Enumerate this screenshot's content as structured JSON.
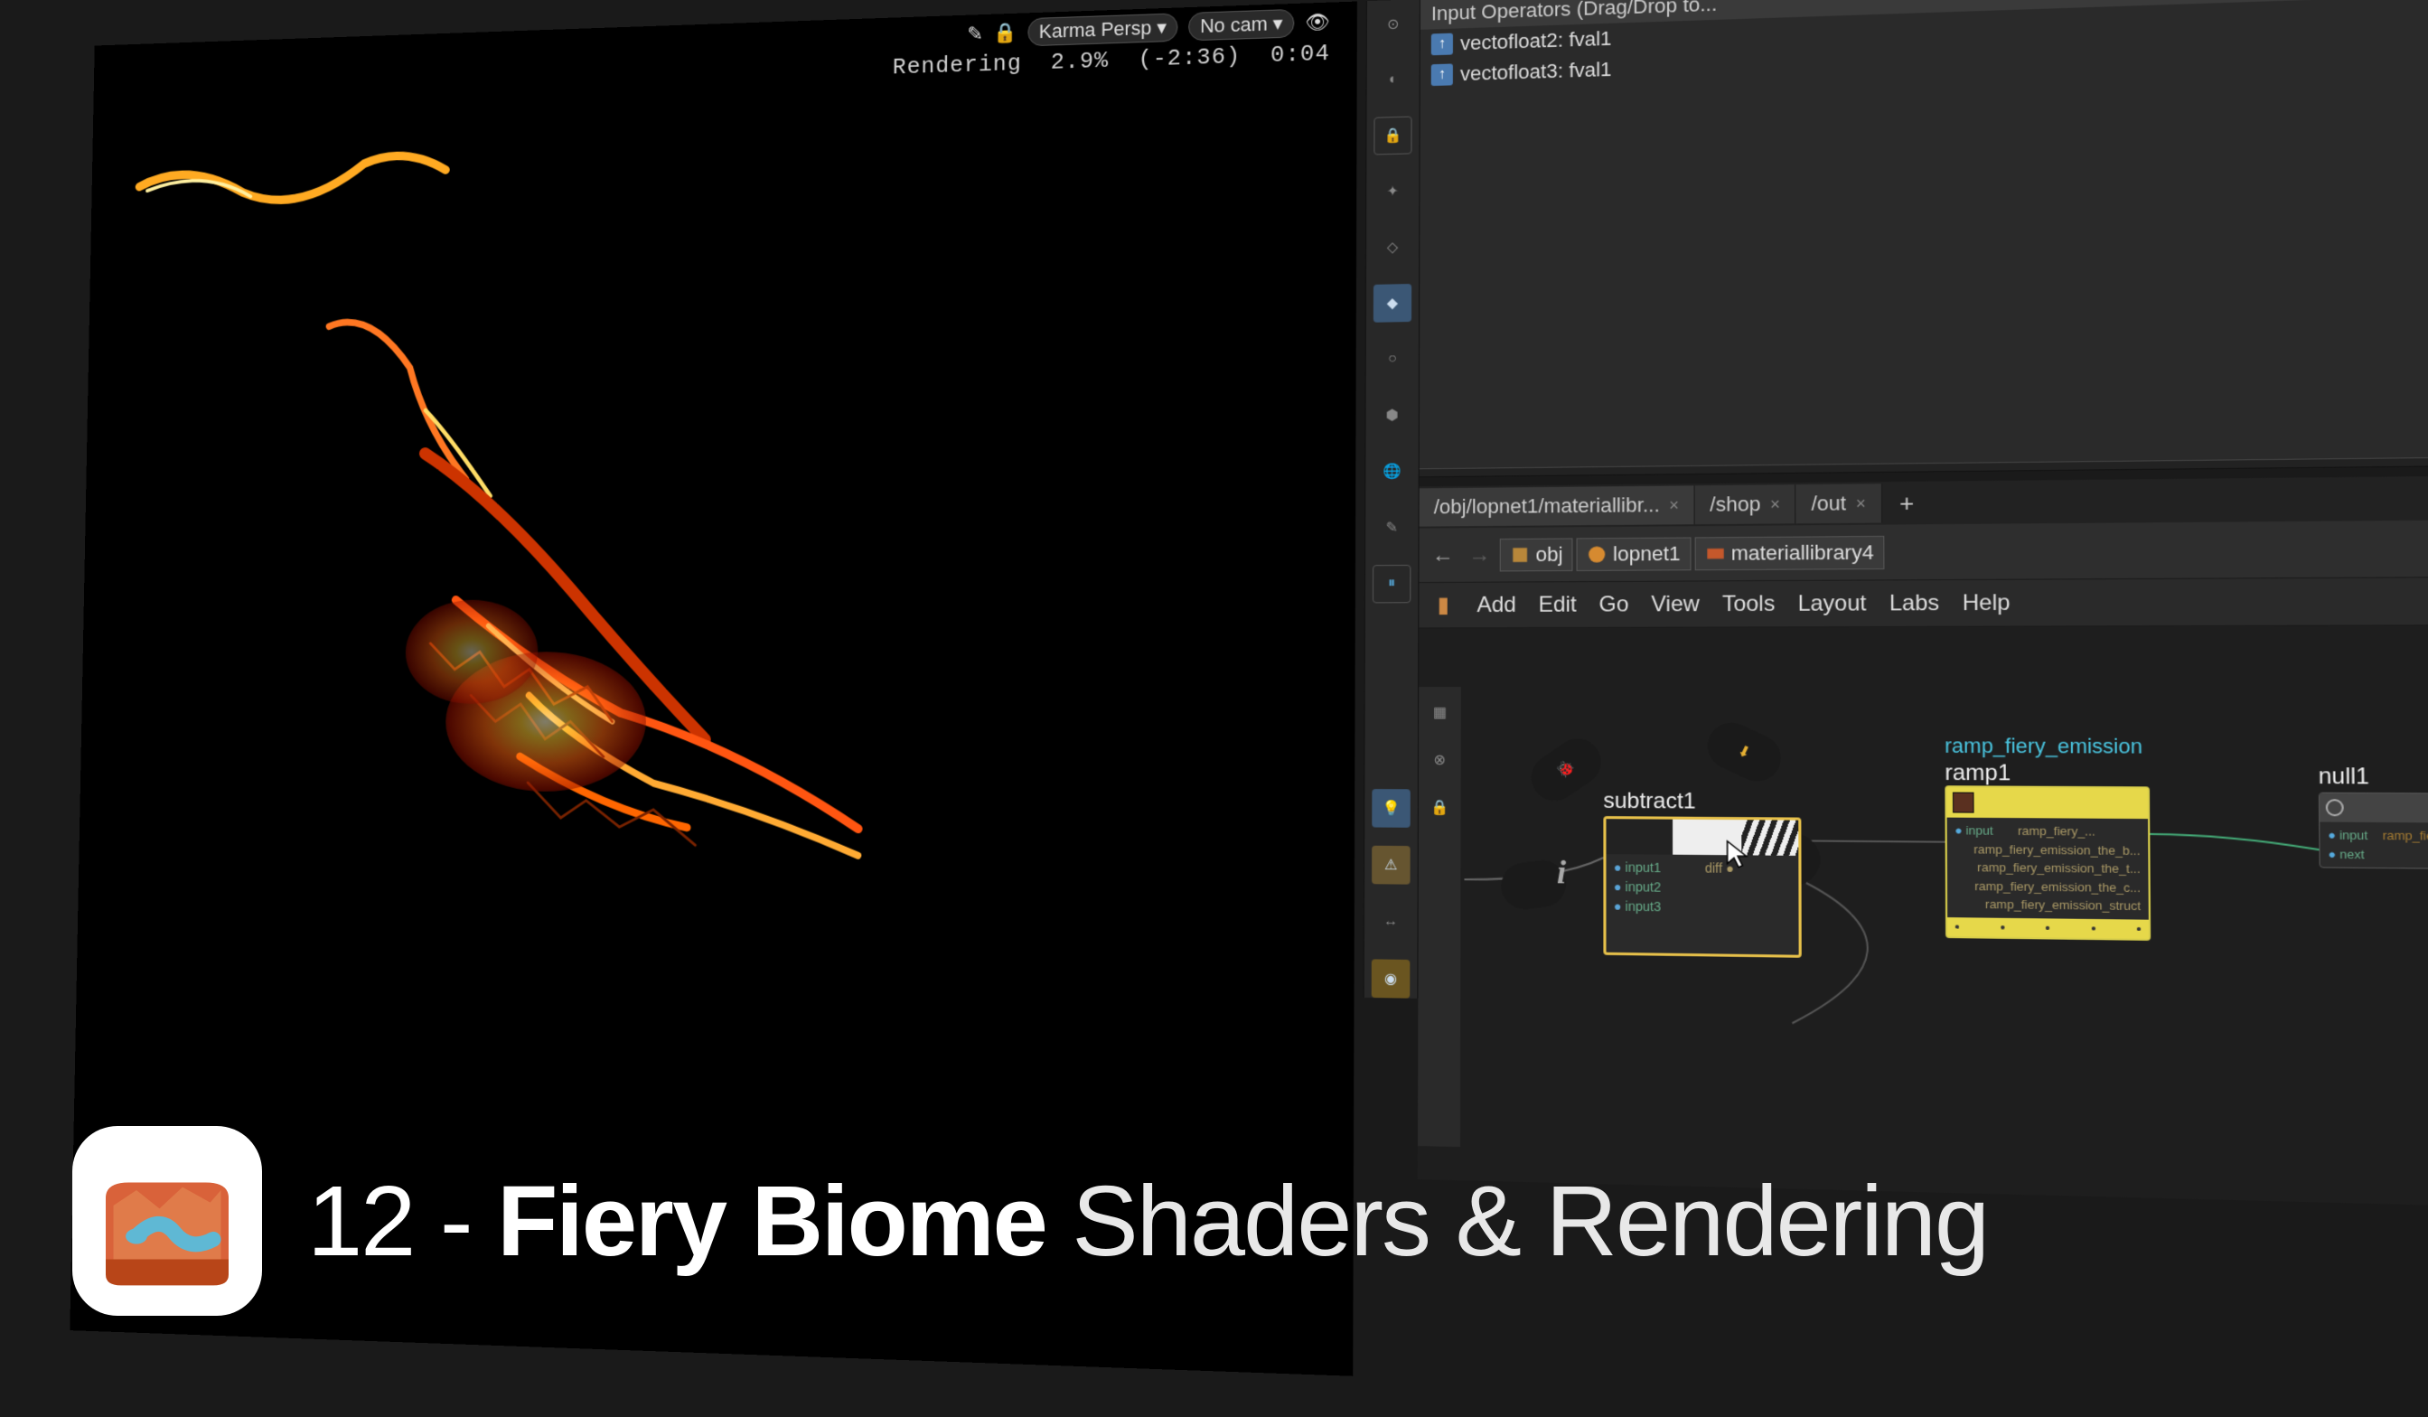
{
  "viewport": {
    "camera_menu": "Karma Persp",
    "cam_selector": "No cam",
    "render_status": "Rendering",
    "progress_pct": "2.9%",
    "elapsed": "(-2:36)",
    "est": "0:04"
  },
  "input_panel": {
    "header": "Input Operators (Drag/Drop to...",
    "items": [
      {
        "label": "vectofloat2: fval1"
      },
      {
        "label": "vectofloat3: fval1"
      }
    ]
  },
  "tabs": [
    {
      "label": "/obj/lopnet1/materiallibr...",
      "active": true
    },
    {
      "label": "/shop",
      "active": false
    },
    {
      "label": "/out",
      "active": false
    }
  ],
  "breadcrumb": [
    {
      "label": "obj",
      "icon": "cube"
    },
    {
      "label": "lopnet1",
      "icon": "lop"
    },
    {
      "label": "materiallibrary4",
      "icon": "mat"
    }
  ],
  "menu": [
    "Add",
    "Edit",
    "Go",
    "View",
    "Tools",
    "Layout",
    "Labs",
    "Help"
  ],
  "nodes": {
    "subtract": {
      "name": "subtract1",
      "inputs": [
        "input1",
        "input2",
        "input3"
      ],
      "output": "diff"
    },
    "ramp": {
      "title": "ramp_fiery_emission",
      "name": "ramp1",
      "inputs": [
        "input"
      ],
      "outputs": [
        "ramp_fiery_...",
        "ramp_fiery_emission_the_b...",
        "ramp_fiery_emission_the_t...",
        "ramp_fiery_emission_the_c...",
        "ramp_fiery_emission_struct"
      ]
    },
    "null": {
      "name": "null1",
      "inputs": [
        "input",
        "next"
      ],
      "outputs": [
        "ramp_fiery_...",
        "ramp_fi..."
      ]
    }
  },
  "overlay": {
    "num": "12 - ",
    "bold": "Fiery Biome",
    "light": " Shaders & Rendering"
  }
}
